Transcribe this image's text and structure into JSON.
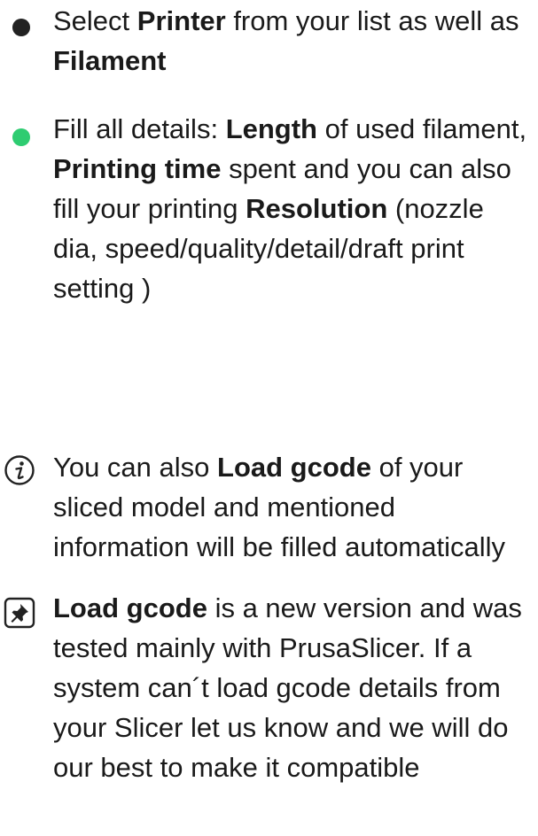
{
  "colors": {
    "bullet_dark": "#222222",
    "bullet_green": "#2ecc71",
    "icon_stroke": "#222222"
  },
  "items": [
    {
      "marker": "dark-bullet",
      "parts": [
        {
          "text": "Select ",
          "bold": false
        },
        {
          "text": "Printer",
          "bold": true
        },
        {
          "text": " from your list as well as ",
          "bold": false
        },
        {
          "text": "Filament",
          "bold": true
        }
      ]
    },
    {
      "marker": "green-bullet",
      "parts": [
        {
          "text": "Fill all details: ",
          "bold": false
        },
        {
          "text": "Length",
          "bold": true
        },
        {
          "text": " of used filament, ",
          "bold": false
        },
        {
          "text": "Printing time",
          "bold": true
        },
        {
          "text": " spent and you can also fill your printing ",
          "bold": false
        },
        {
          "text": "Resolution",
          "bold": true
        },
        {
          "text": " (nozzle dia, speed/quality/detail/draft print setting )",
          "bold": false
        }
      ]
    },
    {
      "marker": "info-icon",
      "parts": [
        {
          "text": "You can also ",
          "bold": false
        },
        {
          "text": "Load gcode",
          "bold": true
        },
        {
          "text": " of your sliced model and mentioned information will be filled automatically",
          "bold": false
        }
      ]
    },
    {
      "marker": "pin-icon",
      "parts": [
        {
          "text": "Load gcode",
          "bold": true
        },
        {
          "text": " is a new version and was tested mainly with PrusaSlicer. If a system can´t load gcode details from your Slicer let us know and we will do our best to make it compatible",
          "bold": false
        }
      ]
    }
  ]
}
